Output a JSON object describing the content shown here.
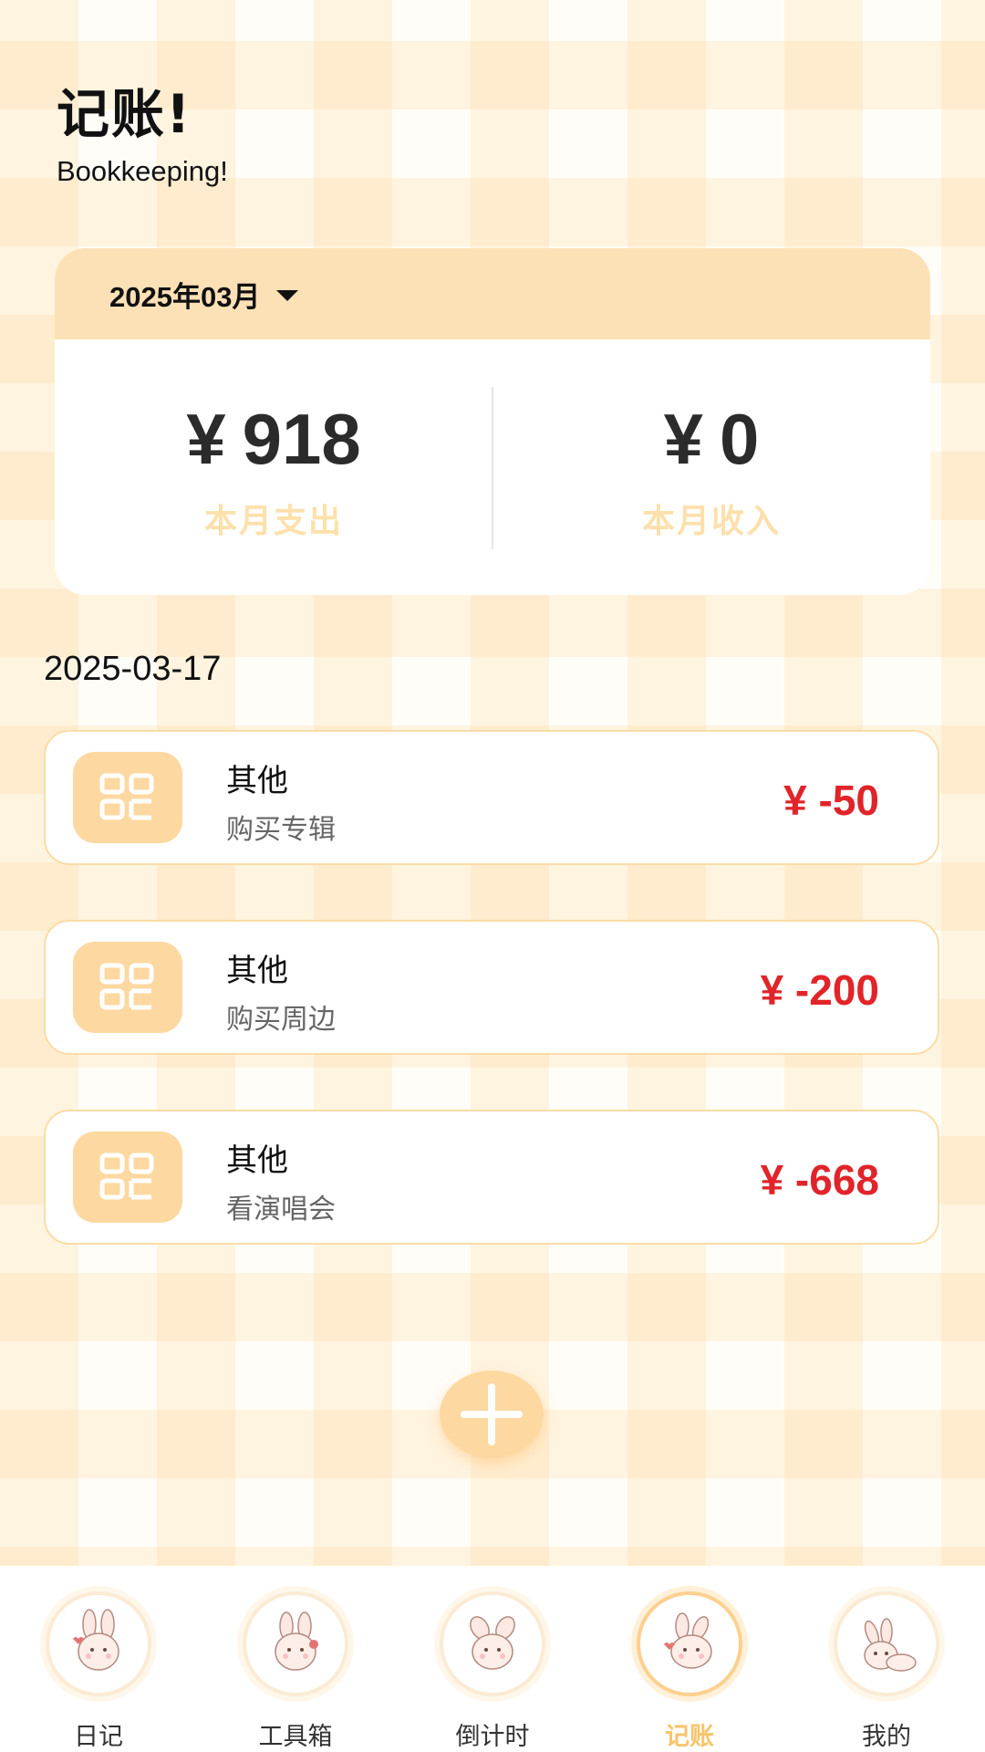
{
  "page": {
    "title": "记账!",
    "subtitle": "Bookkeeping!"
  },
  "summary": {
    "month": "2025年03月",
    "expense": {
      "currency": "¥",
      "amount": "918",
      "label": "本月支出"
    },
    "income": {
      "currency": "¥",
      "amount": "0",
      "label": "本月收入"
    }
  },
  "transactions": {
    "date": "2025-03-17",
    "items": [
      {
        "category": "其他",
        "note": "购买专辑",
        "amount": "¥ -50"
      },
      {
        "category": "其他",
        "note": "购买周边",
        "amount": "¥ -200"
      },
      {
        "category": "其他",
        "note": "看演唱会",
        "amount": "¥ -668"
      }
    ]
  },
  "tabs": [
    {
      "label": "日记",
      "icon": "bunny-diary-icon"
    },
    {
      "label": "工具箱",
      "icon": "bunny-toolbox-icon"
    },
    {
      "label": "倒计时",
      "icon": "bunny-countdown-icon"
    },
    {
      "label": "记账",
      "icon": "bunny-bookkeeping-icon",
      "active": true
    },
    {
      "label": "我的",
      "icon": "bunny-profile-icon"
    }
  ],
  "colors": {
    "accent": "#fdd8a0",
    "expense_red": "#e1242a",
    "label_gold": "#fde0ab",
    "active_tab": "#f9c46c"
  }
}
